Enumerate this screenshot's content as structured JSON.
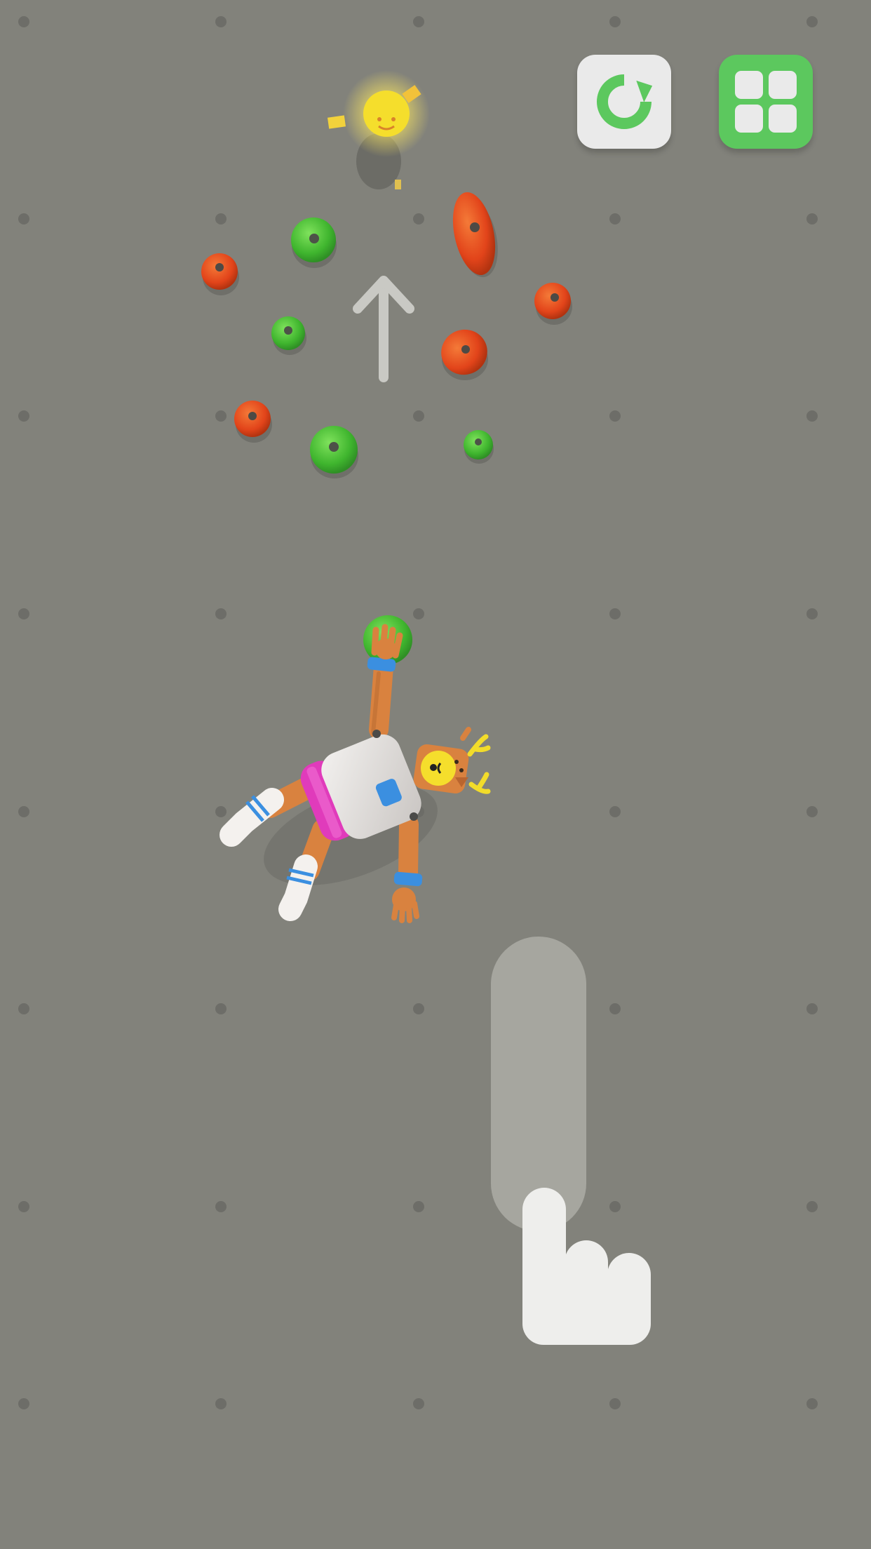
{
  "screen": {
    "background": "#82827b",
    "peg_color": "#6e6e69"
  },
  "buttons": {
    "restart": {
      "icon": "restart-icon",
      "bg": "#eaeaea",
      "icon_color": "#5cc85e"
    },
    "menu": {
      "icon": "grid-menu-icon",
      "bg": "#5cc85e",
      "icon_color": "#eaeaea"
    }
  },
  "holds": {
    "green_color": "#4fc03c",
    "red_color": "#e8461c",
    "goal_color": "#f2dc2a"
  },
  "tutorial": {
    "swipe_direction": "up",
    "arrow_icon": "arrow-up-icon",
    "hand_icon": "pointing-hand-icon"
  },
  "character": {
    "name_icon": "deer-ragdoll-climber",
    "shirt_color": "#e6e2df",
    "shorts_color": "#e03bbb",
    "skin_color": "#d9823f",
    "band_color": "#3b8fe0"
  }
}
